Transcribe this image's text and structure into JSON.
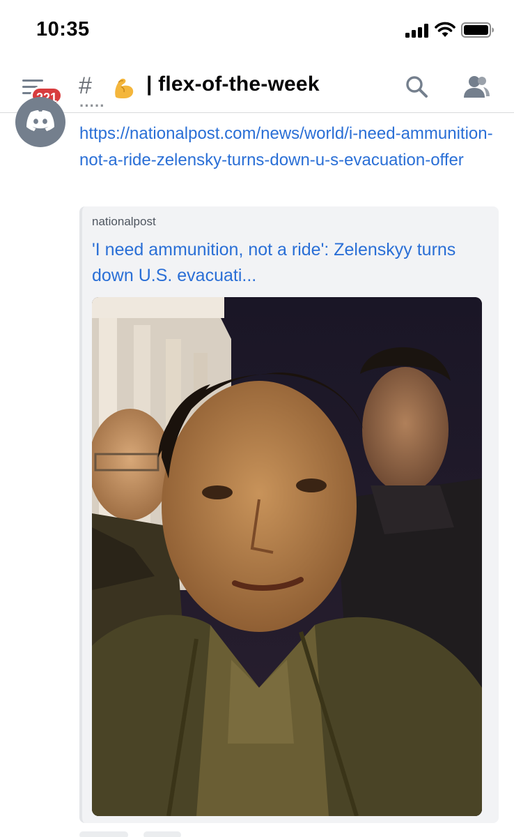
{
  "status_bar": {
    "time": "10:35"
  },
  "channel": {
    "mention_count": "221",
    "hash": "#",
    "emoji": "flexed-biceps-emoji",
    "name": "| flex-of-the-week"
  },
  "message": {
    "link": "https://nationalpost.com/news/world/i-need-ammunition-not-a-ride-zelensky-turns-down-u-s-evacuation-offer",
    "embed": {
      "provider": "nationalpost",
      "title": "'I need ammunition, not a ride': Zelenskyy turns down U.S. evacuati...",
      "image": "three-men-night-selfie-photo"
    }
  },
  "colors": {
    "link": "#2a6fd6",
    "badge": "#d83c3e",
    "embed_bg": "#f2f3f5"
  }
}
